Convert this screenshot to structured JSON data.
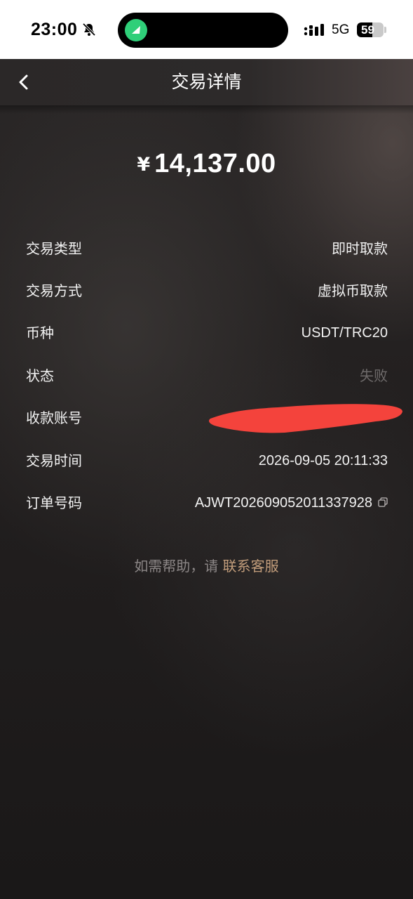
{
  "status_bar": {
    "time": "23:00",
    "network": "5G",
    "battery_level": 59,
    "battery_text": "59",
    "icons": [
      "bell-slash-icon",
      "signal-icon",
      "battery-icon"
    ],
    "island_app_color": "#2fcf79"
  },
  "header": {
    "back_icon": "chevron-left-icon",
    "title": "交易详情"
  },
  "transaction": {
    "currency_symbol": "¥",
    "amount": "14,137.00",
    "rows": [
      {
        "label": "交易类型",
        "value": "即时取款"
      },
      {
        "label": "交易方式",
        "value": "虚拟币取款"
      },
      {
        "label": "币种",
        "value": "USDT/TRC20"
      },
      {
        "label": "状态",
        "value": "失败"
      },
      {
        "label": "收款账号",
        "value": ""
      },
      {
        "label": "交易时间",
        "value": "2026-09-05 20:11:33"
      },
      {
        "label": "订单号码",
        "value": "AJWT202609052011337928"
      }
    ]
  },
  "help": {
    "text": "如需帮助，请",
    "link_label": "联系客服"
  },
  "colors": {
    "status_failed": "#6e6a6a",
    "link": "#c29d7b",
    "redaction": "#f4433c"
  }
}
